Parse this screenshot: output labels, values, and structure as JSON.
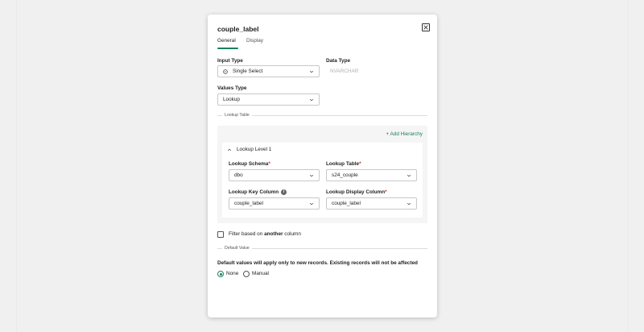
{
  "dialog": {
    "title": "couple_label",
    "tabs": [
      {
        "label": "General",
        "active": true
      },
      {
        "label": "Display",
        "active": false
      }
    ]
  },
  "input_type": {
    "label": "Input Type",
    "value": "Single Select"
  },
  "data_type": {
    "label": "Data Type",
    "value": "NVARCHAR"
  },
  "values_type": {
    "label": "Values Type",
    "value": "Lookup"
  },
  "lookup_table": {
    "section_label": "Lookup Table",
    "add_hierarchy_label": "+ Add Hierarchy",
    "level": {
      "title": "Lookup Level 1",
      "schema": {
        "label": "Lookup Schema",
        "required": "*",
        "value": "dbo"
      },
      "table": {
        "label": "Lookup Table",
        "required": "*",
        "value": "s24_couple"
      },
      "key_column": {
        "label": "Lookup Key Column",
        "info_glyph": "i",
        "value": "couple_label"
      },
      "display_column": {
        "label": "Lookup Display Column",
        "required": "*",
        "value": "couple_label"
      }
    }
  },
  "filter": {
    "label_prefix": "Filter based on ",
    "label_bold": "another",
    "label_suffix": " column",
    "checked": false
  },
  "default_value": {
    "section_label": "Default Value",
    "note": "Default values will apply only to new records. Existing records will not be affected",
    "options": [
      {
        "label": "None",
        "selected": true
      },
      {
        "label": "Manual",
        "selected": false
      }
    ]
  },
  "colors": {
    "accent": "#1a7f5a",
    "required": "#c0392b",
    "panel_bg": "#f5f5f5",
    "backdrop": "#f0f0f0"
  },
  "icons": {
    "close": "close-icon",
    "chevron": "chevron-down-icon",
    "collapse": "chevron-up-icon",
    "info": "info-icon",
    "select_type": "single-select-icon"
  }
}
